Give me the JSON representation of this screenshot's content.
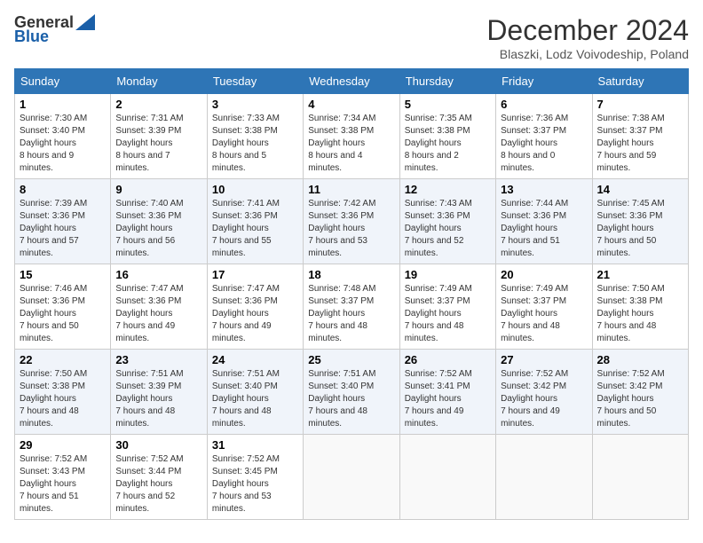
{
  "logo": {
    "general": "General",
    "blue": "Blue"
  },
  "header": {
    "title": "December 2024",
    "subtitle": "Blaszki, Lodz Voivodeship, Poland"
  },
  "weekdays": [
    "Sunday",
    "Monday",
    "Tuesday",
    "Wednesday",
    "Thursday",
    "Friday",
    "Saturday"
  ],
  "weeks": [
    [
      {
        "day": "1",
        "sunrise": "7:30 AM",
        "sunset": "3:40 PM",
        "daylight": "8 hours and 9 minutes."
      },
      {
        "day": "2",
        "sunrise": "7:31 AM",
        "sunset": "3:39 PM",
        "daylight": "8 hours and 7 minutes."
      },
      {
        "day": "3",
        "sunrise": "7:33 AM",
        "sunset": "3:38 PM",
        "daylight": "8 hours and 5 minutes."
      },
      {
        "day": "4",
        "sunrise": "7:34 AM",
        "sunset": "3:38 PM",
        "daylight": "8 hours and 4 minutes."
      },
      {
        "day": "5",
        "sunrise": "7:35 AM",
        "sunset": "3:38 PM",
        "daylight": "8 hours and 2 minutes."
      },
      {
        "day": "6",
        "sunrise": "7:36 AM",
        "sunset": "3:37 PM",
        "daylight": "8 hours and 0 minutes."
      },
      {
        "day": "7",
        "sunrise": "7:38 AM",
        "sunset": "3:37 PM",
        "daylight": "7 hours and 59 minutes."
      }
    ],
    [
      {
        "day": "8",
        "sunrise": "7:39 AM",
        "sunset": "3:36 PM",
        "daylight": "7 hours and 57 minutes."
      },
      {
        "day": "9",
        "sunrise": "7:40 AM",
        "sunset": "3:36 PM",
        "daylight": "7 hours and 56 minutes."
      },
      {
        "day": "10",
        "sunrise": "7:41 AM",
        "sunset": "3:36 PM",
        "daylight": "7 hours and 55 minutes."
      },
      {
        "day": "11",
        "sunrise": "7:42 AM",
        "sunset": "3:36 PM",
        "daylight": "7 hours and 53 minutes."
      },
      {
        "day": "12",
        "sunrise": "7:43 AM",
        "sunset": "3:36 PM",
        "daylight": "7 hours and 52 minutes."
      },
      {
        "day": "13",
        "sunrise": "7:44 AM",
        "sunset": "3:36 PM",
        "daylight": "7 hours and 51 minutes."
      },
      {
        "day": "14",
        "sunrise": "7:45 AM",
        "sunset": "3:36 PM",
        "daylight": "7 hours and 50 minutes."
      }
    ],
    [
      {
        "day": "15",
        "sunrise": "7:46 AM",
        "sunset": "3:36 PM",
        "daylight": "7 hours and 50 minutes."
      },
      {
        "day": "16",
        "sunrise": "7:47 AM",
        "sunset": "3:36 PM",
        "daylight": "7 hours and 49 minutes."
      },
      {
        "day": "17",
        "sunrise": "7:47 AM",
        "sunset": "3:36 PM",
        "daylight": "7 hours and 49 minutes."
      },
      {
        "day": "18",
        "sunrise": "7:48 AM",
        "sunset": "3:37 PM",
        "daylight": "7 hours and 48 minutes."
      },
      {
        "day": "19",
        "sunrise": "7:49 AM",
        "sunset": "3:37 PM",
        "daylight": "7 hours and 48 minutes."
      },
      {
        "day": "20",
        "sunrise": "7:49 AM",
        "sunset": "3:37 PM",
        "daylight": "7 hours and 48 minutes."
      },
      {
        "day": "21",
        "sunrise": "7:50 AM",
        "sunset": "3:38 PM",
        "daylight": "7 hours and 48 minutes."
      }
    ],
    [
      {
        "day": "22",
        "sunrise": "7:50 AM",
        "sunset": "3:38 PM",
        "daylight": "7 hours and 48 minutes."
      },
      {
        "day": "23",
        "sunrise": "7:51 AM",
        "sunset": "3:39 PM",
        "daylight": "7 hours and 48 minutes."
      },
      {
        "day": "24",
        "sunrise": "7:51 AM",
        "sunset": "3:40 PM",
        "daylight": "7 hours and 48 minutes."
      },
      {
        "day": "25",
        "sunrise": "7:51 AM",
        "sunset": "3:40 PM",
        "daylight": "7 hours and 48 minutes."
      },
      {
        "day": "26",
        "sunrise": "7:52 AM",
        "sunset": "3:41 PM",
        "daylight": "7 hours and 49 minutes."
      },
      {
        "day": "27",
        "sunrise": "7:52 AM",
        "sunset": "3:42 PM",
        "daylight": "7 hours and 49 minutes."
      },
      {
        "day": "28",
        "sunrise": "7:52 AM",
        "sunset": "3:42 PM",
        "daylight": "7 hours and 50 minutes."
      }
    ],
    [
      {
        "day": "29",
        "sunrise": "7:52 AM",
        "sunset": "3:43 PM",
        "daylight": "7 hours and 51 minutes."
      },
      {
        "day": "30",
        "sunrise": "7:52 AM",
        "sunset": "3:44 PM",
        "daylight": "7 hours and 52 minutes."
      },
      {
        "day": "31",
        "sunrise": "7:52 AM",
        "sunset": "3:45 PM",
        "daylight": "7 hours and 53 minutes."
      },
      null,
      null,
      null,
      null
    ]
  ],
  "labels": {
    "sunrise": "Sunrise:",
    "sunset": "Sunset:",
    "daylight": "Daylight hours"
  }
}
